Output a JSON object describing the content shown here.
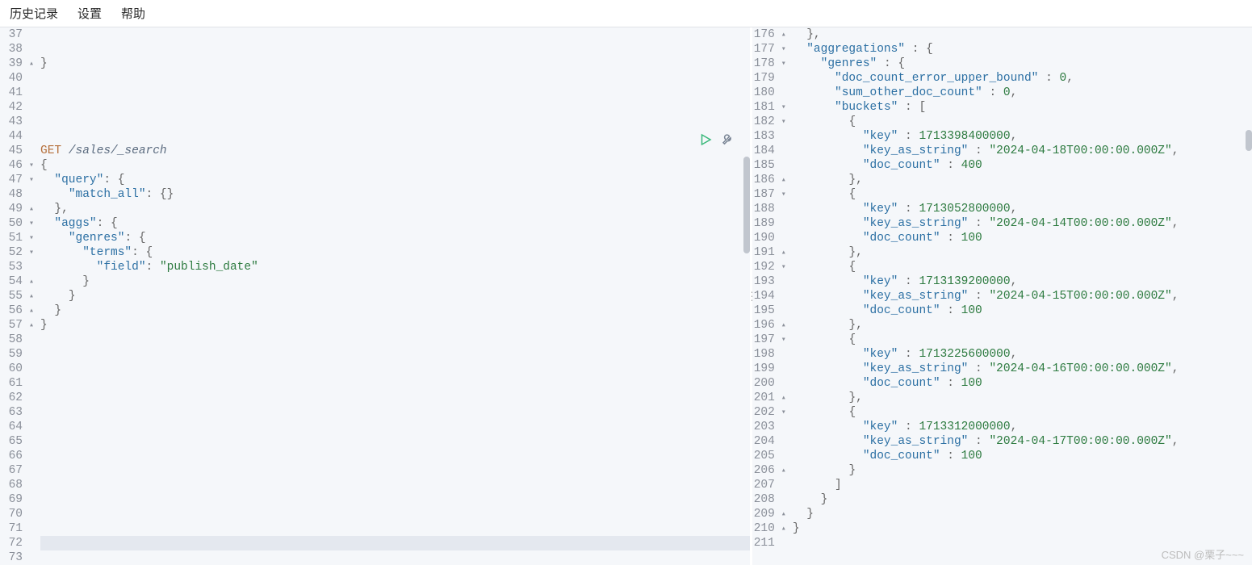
{
  "menubar": {
    "items": [
      "历史记录",
      "设置",
      "帮助"
    ]
  },
  "left_editor": {
    "visible_start": 37,
    "visible_end": 73,
    "highlighted_line": 72,
    "fold_markers": {
      "39": "up",
      "46": "down",
      "47": "down",
      "49": "up",
      "50": "down",
      "51": "down",
      "52": "down",
      "54": "up",
      "55": "up",
      "56": "up",
      "57": "up"
    },
    "request": {
      "line": 45,
      "method": "GET",
      "path": "/sales/_search",
      "body_open_line": 46,
      "body": {
        "query": {
          "match_all": {}
        },
        "aggs": {
          "genres": {
            "terms": {
              "field": "publish_date"
            }
          }
        }
      }
    },
    "scrollbar": {
      "thumb_top_pct": 24,
      "thumb_height_pct": 18
    }
  },
  "right_editor": {
    "visible_start": 176,
    "visible_end": 211,
    "fold_markers": {
      "176": "up",
      "177": "down",
      "178": "down",
      "181": "down",
      "182": "down",
      "186": "up",
      "187": "down",
      "191": "up",
      "192": "down",
      "196": "up",
      "197": "down",
      "201": "up",
      "202": "down",
      "206": "up",
      "209": "up",
      "210": "up"
    },
    "content": {
      "aggregations": {
        "genres": {
          "doc_count_error_upper_bound": 0,
          "sum_other_doc_count": 0,
          "buckets": [
            {
              "key": 1713398400000,
              "key_as_string": "2024-04-18T00:00:00.000Z",
              "doc_count": 400
            },
            {
              "key": 1713052800000,
              "key_as_string": "2024-04-14T00:00:00.000Z",
              "doc_count": 100
            },
            {
              "key": 1713139200000,
              "key_as_string": "2024-04-15T00:00:00.000Z",
              "doc_count": 100
            },
            {
              "key": 1713225600000,
              "key_as_string": "2024-04-16T00:00:00.000Z",
              "doc_count": 100
            },
            {
              "key": 1713312000000,
              "key_as_string": "2024-04-17T00:00:00.000Z",
              "doc_count": 100
            }
          ]
        }
      }
    },
    "scrollbar": {
      "thumb_top_pct": 19,
      "thumb_height_pct": 4
    }
  },
  "actions": {
    "run": "run-icon",
    "wrench": "wrench-icon"
  },
  "colors": {
    "method": "#b56f3a",
    "key": "#2b6fa3",
    "string": "#2c7a3f",
    "number": "#2c7a3f",
    "path": "#5b6b7f",
    "bg": "#f5f7fa"
  },
  "watermark": "CSDN @栗子~~~"
}
